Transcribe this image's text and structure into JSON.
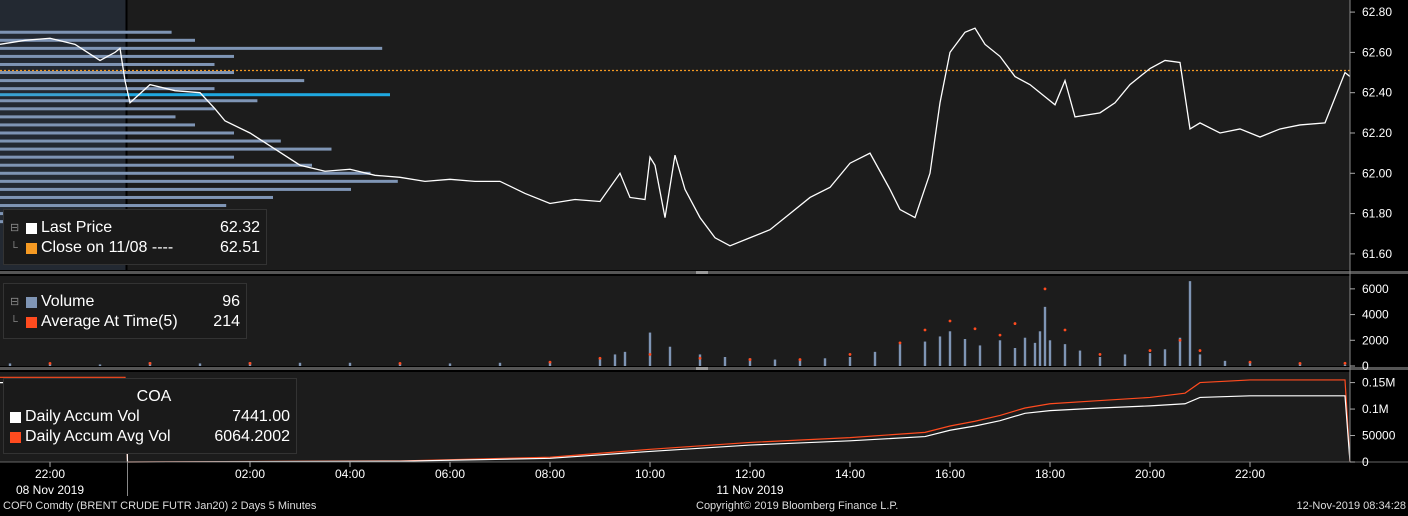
{
  "panels": {
    "price": {
      "legend": [
        {
          "label": "Last Price",
          "value": "62.32",
          "color": "#ffffff"
        },
        {
          "label": "Close on 11/08 ----",
          "value": "62.51",
          "color": "#f59a23"
        }
      ],
      "yticks": [
        "62.80",
        "62.60",
        "62.40",
        "62.20",
        "62.00",
        "61.80",
        "61.60"
      ]
    },
    "volume": {
      "legend": [
        {
          "label": "Volume",
          "value": "96",
          "color": "#7f95b5"
        },
        {
          "label": "Average At Time(5)",
          "value": "214",
          "color": "#ff4b1f"
        }
      ],
      "yticks": [
        "6000",
        "4000",
        "2000",
        "0"
      ]
    },
    "coa": {
      "title": "COA",
      "legend": [
        {
          "label": "Daily Accum Vol",
          "value": "7441.00",
          "color": "#ffffff"
        },
        {
          "label": "Daily Accum Avg Vol",
          "value": "6064.2002",
          "color": "#ff4b1f"
        }
      ],
      "yticks": [
        "0.15M",
        "0.1M",
        "50000",
        "0"
      ]
    }
  },
  "xaxis": {
    "ticks": [
      "22:00",
      "02:00",
      "04:00",
      "06:00",
      "08:00",
      "10:00",
      "12:00",
      "14:00",
      "16:00",
      "18:00",
      "20:00",
      "22:00"
    ],
    "dates": [
      "08 Nov 2019",
      "11 Nov 2019"
    ]
  },
  "footer": {
    "left": "COF0 Comdty (BRENT CRUDE FUTR  Jan20) 2 Days 5 Minutes",
    "center": "Copyright© 2019 Bloomberg Finance L.P.",
    "right": "12-Nov-2019 08:34:28"
  },
  "colors": {
    "price_line": "#ffffff",
    "close_line": "#f59a23",
    "profile_bar": "#7f95b5",
    "volume_bar": "#7f95b5",
    "avg_dot": "#ff4b1f",
    "poc_line": "#1fa8e0",
    "shaded_prev_day": "#262626"
  },
  "chart_data": [
    {
      "type": "line",
      "title": "",
      "xlabel": "",
      "ylabel": "",
      "ylim": [
        61.52,
        62.86
      ],
      "grid": false,
      "legend_position": "bottom-left",
      "x_unit": "hours since 08 Nov 2019 21:00",
      "x_ticks": [
        {
          "x": 1,
          "label": "22:00"
        },
        {
          "x": 5,
          "label": "02:00"
        },
        {
          "x": 7,
          "label": "04:00"
        },
        {
          "x": 9,
          "label": "06:00"
        },
        {
          "x": 11,
          "label": "08:00"
        },
        {
          "x": 13,
          "label": "10:00"
        },
        {
          "x": 15,
          "label": "12:00"
        },
        {
          "x": 17,
          "label": "14:00"
        },
        {
          "x": 19,
          "label": "16:00"
        },
        {
          "x": 21,
          "label": "18:00"
        },
        {
          "x": 23,
          "label": "20:00"
        },
        {
          "x": 25,
          "label": "22:00"
        }
      ],
      "series": [
        {
          "name": "Last Price",
          "values": [
            [
              0.0,
              62.64
            ],
            [
              0.5,
              62.66
            ],
            [
              1.0,
              62.67
            ],
            [
              1.5,
              62.64
            ],
            [
              2.0,
              62.56
            ],
            [
              2.3,
              62.6
            ],
            [
              2.4,
              62.62
            ],
            [
              2.5,
              62.46
            ],
            [
              2.6,
              62.35
            ],
            [
              3.0,
              62.44
            ],
            [
              3.5,
              62.41
            ],
            [
              4.0,
              62.4
            ],
            [
              4.3,
              62.32
            ],
            [
              4.5,
              62.26
            ],
            [
              5.0,
              62.2
            ],
            [
              5.5,
              62.12
            ],
            [
              6.0,
              62.04
            ],
            [
              6.5,
              62.01
            ],
            [
              7.0,
              62.02
            ],
            [
              7.5,
              61.99
            ],
            [
              8.0,
              61.98
            ],
            [
              8.5,
              61.96
            ],
            [
              9.0,
              61.97
            ],
            [
              9.5,
              61.96
            ],
            [
              10.0,
              61.96
            ],
            [
              10.5,
              61.9
            ],
            [
              11.0,
              61.85
            ],
            [
              11.5,
              61.87
            ],
            [
              12.0,
              61.86
            ],
            [
              12.4,
              62.0
            ],
            [
              12.6,
              61.88
            ],
            [
              12.9,
              61.87
            ],
            [
              13.0,
              62.08
            ],
            [
              13.1,
              62.04
            ],
            [
              13.3,
              61.78
            ],
            [
              13.5,
              62.09
            ],
            [
              13.7,
              61.92
            ],
            [
              14.0,
              61.78
            ],
            [
              14.3,
              61.68
            ],
            [
              14.6,
              61.64
            ],
            [
              15.0,
              61.68
            ],
            [
              15.4,
              61.72
            ],
            [
              15.8,
              61.8
            ],
            [
              16.2,
              61.88
            ],
            [
              16.6,
              61.93
            ],
            [
              17.0,
              62.05
            ],
            [
              17.4,
              62.1
            ],
            [
              17.8,
              61.92
            ],
            [
              18.0,
              61.82
            ],
            [
              18.3,
              61.78
            ],
            [
              18.6,
              62.0
            ],
            [
              18.8,
              62.35
            ],
            [
              19.0,
              62.6
            ],
            [
              19.3,
              62.7
            ],
            [
              19.5,
              62.72
            ],
            [
              19.7,
              62.64
            ],
            [
              20.0,
              62.58
            ],
            [
              20.3,
              62.48
            ],
            [
              20.6,
              62.44
            ],
            [
              20.9,
              62.38
            ],
            [
              21.1,
              62.34
            ],
            [
              21.3,
              62.46
            ],
            [
              21.5,
              62.28
            ],
            [
              22.0,
              62.3
            ],
            [
              22.3,
              62.35
            ],
            [
              22.6,
              62.44
            ],
            [
              23.0,
              62.52
            ],
            [
              23.3,
              62.56
            ],
            [
              23.6,
              62.55
            ],
            [
              23.8,
              62.22
            ],
            [
              24.0,
              62.25
            ],
            [
              24.4,
              62.2
            ],
            [
              24.8,
              62.22
            ],
            [
              25.2,
              62.18
            ],
            [
              25.6,
              62.22
            ],
            [
              26.0,
              62.24
            ],
            [
              26.5,
              62.25
            ],
            [
              26.9,
              62.5
            ],
            [
              27.0,
              62.48
            ]
          ]
        },
        {
          "name": "Close on 11/08",
          "values": [
            [
              0.0,
              62.51
            ],
            [
              27.0,
              62.51
            ]
          ]
        }
      ]
    },
    {
      "type": "bar",
      "title": "",
      "ylim": [
        0,
        7000
      ],
      "legend_position": "top-left",
      "series": [
        {
          "name": "Volume",
          "values": [
            [
              0.2,
              200
            ],
            [
              1.0,
              150
            ],
            [
              2.0,
              120
            ],
            [
              3.0,
              300
            ],
            [
              4.0,
              200
            ],
            [
              5.0,
              300
            ],
            [
              6.0,
              250
            ],
            [
              7.0,
              250
            ],
            [
              8.0,
              200
            ],
            [
              9.0,
              200
            ],
            [
              10.0,
              250
            ],
            [
              11.0,
              300
            ],
            [
              12.0,
              600
            ],
            [
              12.3,
              900
            ],
            [
              12.5,
              1100
            ],
            [
              13.0,
              2600
            ],
            [
              13.4,
              1500
            ],
            [
              14.0,
              900
            ],
            [
              14.5,
              700
            ],
            [
              15.0,
              600
            ],
            [
              15.5,
              500
            ],
            [
              16.0,
              500
            ],
            [
              16.5,
              600
            ],
            [
              17.0,
              700
            ],
            [
              17.5,
              1100
            ],
            [
              18.0,
              1700
            ],
            [
              18.5,
              1900
            ],
            [
              18.8,
              2300
            ],
            [
              19.0,
              2700
            ],
            [
              19.3,
              2100
            ],
            [
              19.6,
              1600
            ],
            [
              20.0,
              2000
            ],
            [
              20.3,
              1400
            ],
            [
              20.5,
              2200
            ],
            [
              20.7,
              1800
            ],
            [
              20.8,
              2700
            ],
            [
              20.9,
              4600
            ],
            [
              21.0,
              2000
            ],
            [
              21.3,
              1700
            ],
            [
              21.6,
              1200
            ],
            [
              22.0,
              700
            ],
            [
              22.5,
              900
            ],
            [
              23.0,
              1000
            ],
            [
              23.3,
              1300
            ],
            [
              23.6,
              2200
            ],
            [
              23.8,
              6600
            ],
            [
              24.0,
              900
            ],
            [
              24.5,
              400
            ],
            [
              25.0,
              300
            ],
            [
              26.0,
              250
            ],
            [
              26.9,
              100
            ]
          ]
        },
        {
          "name": "Average At Time(5)",
          "values": [
            [
              1.0,
              200
            ],
            [
              3.0,
              200
            ],
            [
              5.0,
              200
            ],
            [
              8.0,
              200
            ],
            [
              11.0,
              300
            ],
            [
              12.0,
              600
            ],
            [
              13.0,
              900
            ],
            [
              14.0,
              600
            ],
            [
              15.0,
              500
            ],
            [
              16.0,
              500
            ],
            [
              17.0,
              900
            ],
            [
              18.0,
              1800
            ],
            [
              18.5,
              2800
            ],
            [
              19.0,
              3500
            ],
            [
              19.5,
              2900
            ],
            [
              20.0,
              2400
            ],
            [
              20.3,
              3300
            ],
            [
              20.9,
              6000
            ],
            [
              21.3,
              2800
            ],
            [
              22.0,
              900
            ],
            [
              23.0,
              1200
            ],
            [
              23.6,
              2000
            ],
            [
              24.0,
              1200
            ],
            [
              25.0,
              300
            ],
            [
              26.0,
              200
            ],
            [
              26.9,
              214
            ]
          ]
        }
      ]
    },
    {
      "type": "line",
      "title": "COA",
      "ylim": [
        0,
        170000
      ],
      "legend_position": "top-left",
      "series": [
        {
          "name": "Daily Accum Vol",
          "values": [
            [
              0.0,
              150000
            ],
            [
              2.5,
              150000
            ],
            [
              2.55,
              0
            ],
            [
              8.0,
              1500
            ],
            [
              11.0,
              7000
            ],
            [
              13.0,
              20000
            ],
            [
              15.0,
              32000
            ],
            [
              17.0,
              40000
            ],
            [
              18.5,
              48000
            ],
            [
              19.0,
              60000
            ],
            [
              19.5,
              68000
            ],
            [
              20.0,
              78000
            ],
            [
              20.5,
              92000
            ],
            [
              21.0,
              97000
            ],
            [
              22.0,
              102000
            ],
            [
              23.0,
              106000
            ],
            [
              23.7,
              110000
            ],
            [
              24.0,
              122000
            ],
            [
              25.0,
              125000
            ],
            [
              26.9,
              125000
            ],
            [
              27.0,
              0
            ]
          ]
        },
        {
          "name": "Daily Accum Avg Vol",
          "values": [
            [
              0.0,
              160000
            ],
            [
              2.5,
              160000
            ],
            [
              2.55,
              0
            ],
            [
              8.0,
              2000
            ],
            [
              11.0,
              9000
            ],
            [
              13.0,
              24000
            ],
            [
              15.0,
              37000
            ],
            [
              17.0,
              46000
            ],
            [
              18.5,
              56000
            ],
            [
              19.0,
              68000
            ],
            [
              19.5,
              77000
            ],
            [
              20.0,
              88000
            ],
            [
              20.5,
              102000
            ],
            [
              21.0,
              110000
            ],
            [
              22.0,
              116000
            ],
            [
              23.0,
              122000
            ],
            [
              23.7,
              130000
            ],
            [
              24.0,
              150000
            ],
            [
              25.0,
              155000
            ],
            [
              26.9,
              155000
            ],
            [
              27.0,
              0
            ]
          ]
        }
      ]
    },
    {
      "type": "bar",
      "title": "",
      "orientation": "horizontal",
      "ylim": [
        61.52,
        62.86
      ],
      "series": [
        {
          "name": "",
          "values": [
            [
              62.7,
              0.44
            ],
            [
              62.66,
              0.5
            ],
            [
              62.62,
              0.98
            ],
            [
              62.58,
              0.6
            ],
            [
              62.54,
              0.55
            ],
            [
              62.5,
              0.6
            ],
            [
              62.46,
              0.78
            ],
            [
              62.42,
              0.55
            ],
            [
              62.39,
              1.0
            ],
            [
              62.36,
              0.66
            ],
            [
              62.32,
              0.55
            ],
            [
              62.28,
              0.45
            ],
            [
              62.24,
              0.5
            ],
            [
              62.2,
              0.6
            ],
            [
              62.16,
              0.72
            ],
            [
              62.12,
              0.85
            ],
            [
              62.08,
              0.6
            ],
            [
              62.04,
              0.8
            ],
            [
              62.0,
              0.95
            ],
            [
              61.96,
              1.02
            ],
            [
              61.92,
              0.9
            ],
            [
              61.88,
              0.7
            ],
            [
              61.84,
              0.58
            ],
            [
              61.8,
              0.5
            ],
            [
              61.76,
              0.4
            ]
          ]
        }
      ]
    }
  ]
}
